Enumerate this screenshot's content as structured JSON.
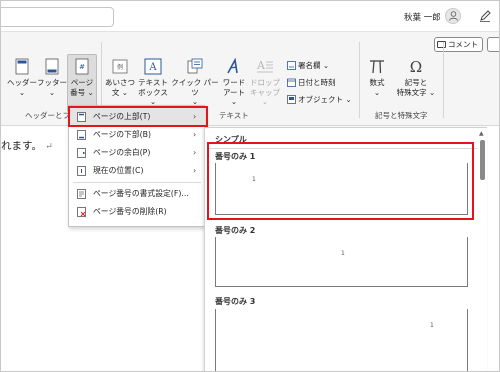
{
  "titlebar": {
    "user_name": "秋葉 一郎"
  },
  "ribbon": {
    "comment_label": "コメント",
    "buttons": {
      "header": [
        "ヘッダー",
        "⌄"
      ],
      "footer": [
        "フッター",
        "⌄"
      ],
      "page_number": [
        "ページ",
        "番号 ⌄"
      ],
      "greeting": [
        "あいさつ",
        "文 ⌄"
      ],
      "textbox": [
        "テキスト",
        "ボックス ⌄"
      ],
      "quickparts": [
        "クイック パーツ",
        "⌄"
      ],
      "wordart": [
        "ワード",
        "アート ⌄"
      ],
      "dropcap": [
        "ドロップ",
        "キャップ ⌄"
      ],
      "equation": [
        "数式",
        "⌄"
      ],
      "symbol": [
        "記号と",
        "特殊文字 ⌄"
      ]
    },
    "small_buttons": {
      "signature": "署名欄  ⌄",
      "datetime": "日付と時刻",
      "object": "オブジェクト  ⌄"
    },
    "groups": {
      "header_footer": "ヘッダーとフッ",
      "text": "テキスト",
      "symbols": "記号と特殊文字"
    }
  },
  "document": {
    "text": "れます。",
    "return_mark": "↵"
  },
  "menu": {
    "items": [
      {
        "label": "ページの上部(T)",
        "arrow": "›"
      },
      {
        "label": "ページの下部(B)",
        "arrow": "›"
      },
      {
        "label": "ページの余白(P)",
        "arrow": "›"
      },
      {
        "label": "現在の位置(C)",
        "arrow": "›"
      },
      {
        "label": "ページ番号の書式設定(F)..."
      },
      {
        "label": "ページ番号の削除(R)"
      }
    ]
  },
  "gallery": {
    "header": "シンプル",
    "items": [
      {
        "label": "番号のみ 1",
        "num": "1",
        "align": "left"
      },
      {
        "label": "番号のみ 2",
        "num": "1",
        "align": "center"
      },
      {
        "label": "番号のみ 3",
        "num": "1",
        "align": "right"
      }
    ]
  },
  "colors": {
    "highlight": "#e5141c",
    "accent": "#2b579a",
    "ribbon_bg": "#f5f5f5"
  }
}
